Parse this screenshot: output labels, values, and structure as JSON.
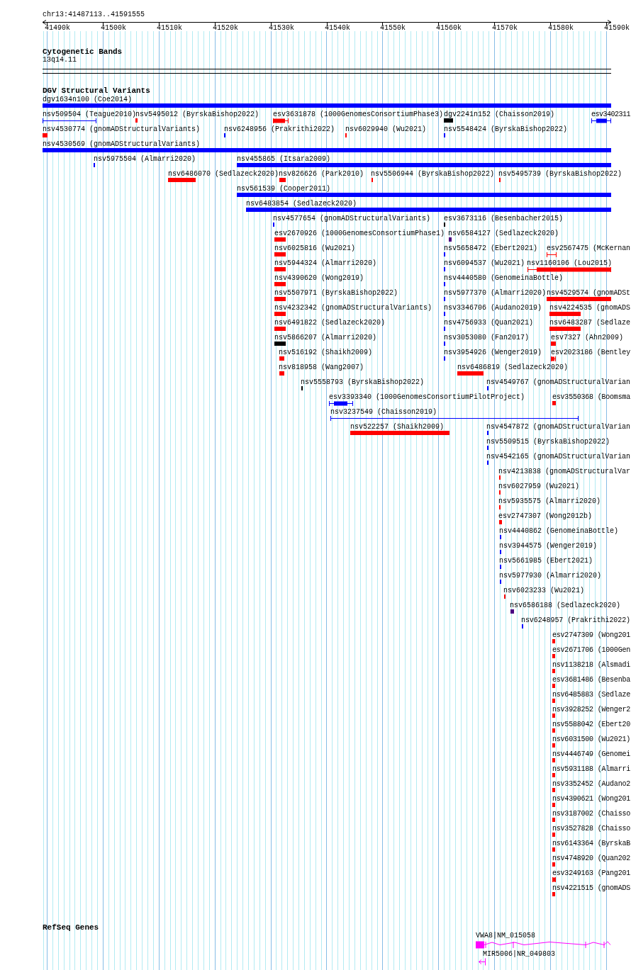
{
  "ruler": {
    "location": "chr13:41487113..41591555",
    "ticks": [
      "41490k",
      "41500k",
      "41510k",
      "41520k",
      "41530k",
      "41540k",
      "41550k",
      "41560k",
      "41570k",
      "41580k",
      "41590k"
    ]
  },
  "cytogenetic_bands": {
    "title": "Cytogenetic Bands",
    "band": "13q14.11"
  },
  "dgv_track": {
    "title": "DGV Structural Variants",
    "features": [
      {
        "label": "dgv1634n100 (Coe2014)",
        "color": "#0000ff",
        "kind": "bar"
      },
      {
        "label": "nsv509504 (Teague2010)",
        "color": "#0000ff",
        "kind": "span"
      },
      {
        "label": "nsv5495012 (ByrskaBishop2022)",
        "color": "#ff0000",
        "kind": "bar"
      },
      {
        "label": "esv3631878 (1000GenomesConsortiumPhase3)",
        "color": "#ff0000",
        "kind": "gapped"
      },
      {
        "label": "dgv2241n152 (Chaisson2019)",
        "color": "#000000",
        "kind": "bar"
      },
      {
        "label": "esv3402311",
        "color": "#0000ff",
        "kind": "gapped"
      },
      {
        "label": "nsv4530774 (gnomADStructuralVariants)",
        "color": "#ff0000",
        "kind": "bar"
      },
      {
        "label": "nsv6248956 (Prakrithi2022)",
        "color": "#0000ff",
        "kind": "bar"
      },
      {
        "label": "nsv6029940 (Wu2021)",
        "color": "#ff0000",
        "kind": "bar"
      },
      {
        "label": "nsv5548424 (ByrskaBishop2022)",
        "color": "#0000ff",
        "kind": "bar"
      },
      {
        "label": "nsv4530569 (gnomADStructuralVariants)",
        "color": "#0000ff",
        "kind": "bar"
      },
      {
        "label": "nsv5975504 (Almarri2020)",
        "color": "#0000ff",
        "kind": "bar"
      },
      {
        "label": "nsv455865 (Itsara2009)",
        "color": "#0000ff",
        "kind": "bar"
      },
      {
        "label": "nsv6486070 (Sedlazeck2020)",
        "color": "#ff0000",
        "kind": "bar"
      },
      {
        "label": "nsv826626 (Park2010)",
        "color": "#ff0000",
        "kind": "bar"
      },
      {
        "label": "nsv5506944 (ByrskaBishop2022)",
        "color": "#ff0000",
        "kind": "bar"
      },
      {
        "label": "nsv5495739 (ByrskaBishop2022)",
        "color": "#ff0000",
        "kind": "bar"
      },
      {
        "label": "nsv561539 (Cooper2011)",
        "color": "#0000ff",
        "kind": "bar"
      },
      {
        "label": "nsv6483854 (Sedlazeck2020)",
        "color": "#0000ff",
        "kind": "bar"
      },
      {
        "label": "nsv4577654 (gnomADStructuralVariants)",
        "color": "#0000ff",
        "kind": "bar"
      },
      {
        "label": "esv3673116 (Besenbacher2015)",
        "color": "#000000",
        "kind": "bar"
      },
      {
        "label": "esv2670926 (1000GenomesConsortiumPhase1)",
        "color": "#ff0000",
        "kind": "bar"
      },
      {
        "label": "nsv6584127 (Sedlazeck2020)",
        "color": "#4b0082",
        "kind": "bar"
      },
      {
        "label": "nsv6025816 (Wu2021)",
        "color": "#ff0000",
        "kind": "bar"
      },
      {
        "label": "nsv5658472 (Ebert2021)",
        "color": "#0000ff",
        "kind": "bar"
      },
      {
        "label": "esv2567475 (McKernan",
        "color": "#ff0000",
        "kind": "span"
      },
      {
        "label": "nsv5944324 (Almarri2020)",
        "color": "#ff0000",
        "kind": "bar"
      },
      {
        "label": "nsv6094537 (Wu2021)",
        "color": "#0000ff",
        "kind": "bar"
      },
      {
        "label": "nsv1160106 (Lou2015)",
        "color": "#ff0000",
        "kind": "gapped"
      },
      {
        "label": "nsv4390620 (Wong2019)",
        "color": "#ff0000",
        "kind": "bar"
      },
      {
        "label": "nsv4440580 (GenomeinaBottle)",
        "color": "#0000ff",
        "kind": "bar"
      },
      {
        "label": "nsv5507971 (ByrskaBishop2022)",
        "color": "#ff0000",
        "kind": "bar"
      },
      {
        "label": "nsv5977370 (Almarri2020)",
        "color": "#0000ff",
        "kind": "bar"
      },
      {
        "label": "nsv4529574 (gnomADSt",
        "color": "#ff0000",
        "kind": "bar"
      },
      {
        "label": "nsv4232342 (gnomADStructuralVariants)",
        "color": "#ff0000",
        "kind": "bar"
      },
      {
        "label": "nsv3346706 (Audano2019)",
        "color": "#0000ff",
        "kind": "bar"
      },
      {
        "label": "nsv4224535 (gnomADS",
        "color": "#ff0000",
        "kind": "bar"
      },
      {
        "label": "nsv6491822 (Sedlazeck2020)",
        "color": "#ff0000",
        "kind": "bar"
      },
      {
        "label": "nsv4756933 (Quan2021)",
        "color": "#0000ff",
        "kind": "bar"
      },
      {
        "label": "nsv6483287 (Sedlaze",
        "color": "#ff0000",
        "kind": "bar"
      },
      {
        "label": "nsv5866207 (Almarri2020)",
        "color": "#000000",
        "kind": "bar"
      },
      {
        "label": "nsv3053080 (Fan2017)",
        "color": "#0000ff",
        "kind": "bar"
      },
      {
        "label": "esv7327 (Ahn2009)",
        "color": "#ff0000",
        "kind": "bar"
      },
      {
        "label": "nsv516192 (Shaikh2009)",
        "color": "#ff0000",
        "kind": "bar"
      },
      {
        "label": "nsv3954926 (Wenger2019)",
        "color": "#0000ff",
        "kind": "bar"
      },
      {
        "label": "esv2023186 (Bentley",
        "color": "#ff0000",
        "kind": "gapped"
      },
      {
        "label": "nsv818958 (Wang2007)",
        "color": "#ff0000",
        "kind": "bar"
      },
      {
        "label": "nsv6486819 (Sedlazeck2020)",
        "color": "#ff0000",
        "kind": "bar"
      },
      {
        "label": "nsv5558793 (ByrskaBishop2022)",
        "color": "#000000",
        "kind": "bar"
      },
      {
        "label": "nsv4549767 (gnomADStructuralVarian",
        "color": "#0000ff",
        "kind": "bar"
      },
      {
        "label": "esv3393340 (1000GenomesConsortiumPilotProject)",
        "color": "#0000ff",
        "kind": "gapped"
      },
      {
        "label": "esv3550368 (Boomsma",
        "color": "#ff0000",
        "kind": "bar"
      },
      {
        "label": "nsv3237549 (Chaisson2019)",
        "color": "#0000ff",
        "kind": "span"
      },
      {
        "label": "nsv522257 (Shaikh2009)",
        "color": "#ff0000",
        "kind": "bar"
      },
      {
        "label": "nsv4547872 (gnomADStructuralVarian",
        "color": "#0000ff",
        "kind": "bar"
      },
      {
        "label": "nsv5509515 (ByrskaBishop2022)",
        "color": "#0000ff",
        "kind": "bar"
      },
      {
        "label": "nsv4542165 (gnomADStructuralVarian",
        "color": "#0000ff",
        "kind": "bar"
      },
      {
        "label": "nsv4213838 (gnomADStructuralVar",
        "color": "#ff0000",
        "kind": "bar"
      },
      {
        "label": "nsv6027959 (Wu2021)",
        "color": "#ff0000",
        "kind": "bar"
      },
      {
        "label": "nsv5935575 (Almarri2020)",
        "color": "#ff0000",
        "kind": "bar"
      },
      {
        "label": "esv2747307 (Wong2012b)",
        "color": "#ff0000",
        "kind": "bar"
      },
      {
        "label": "nsv4440862 (GenomeinaBottle)",
        "color": "#0000ff",
        "kind": "bar"
      },
      {
        "label": "nsv3944575 (Wenger2019)",
        "color": "#0000ff",
        "kind": "bar"
      },
      {
        "label": "nsv5661985 (Ebert2021)",
        "color": "#0000ff",
        "kind": "bar"
      },
      {
        "label": "nsv5977930 (Almarri2020)",
        "color": "#0000ff",
        "kind": "bar"
      },
      {
        "label": "nsv6023233 (Wu2021)",
        "color": "#ff0000",
        "kind": "bar"
      },
      {
        "label": "nsv6586188 (Sedlazeck2020)",
        "color": "#4b0082",
        "kind": "bar"
      },
      {
        "label": "nsv6248957 (Prakrithi2022)",
        "color": "#0000ff",
        "kind": "bar"
      },
      {
        "label": "esv2747309 (Wong201",
        "color": "#ff0000",
        "kind": "bar"
      },
      {
        "label": "esv2671706 (1000Gen",
        "color": "#ff0000",
        "kind": "bar"
      },
      {
        "label": "nsv1138218 (Alsmadi",
        "color": "#ff0000",
        "kind": "bar"
      },
      {
        "label": "esv3681486 (Besenba",
        "color": "#ff0000",
        "kind": "bar"
      },
      {
        "label": "nsv6485883 (Sedlaze",
        "color": "#ff0000",
        "kind": "bar"
      },
      {
        "label": "nsv3928252 (Wenger2",
        "color": "#ff0000",
        "kind": "bar"
      },
      {
        "label": "nsv5588042 (Ebert20",
        "color": "#ff0000",
        "kind": "bar"
      },
      {
        "label": "nsv6031500 (Wu2021)",
        "color": "#ff0000",
        "kind": "bar"
      },
      {
        "label": "nsv4446749 (Genomei",
        "color": "#ff0000",
        "kind": "bar"
      },
      {
        "label": "nsv5931188 (Almarri",
        "color": "#ff0000",
        "kind": "bar"
      },
      {
        "label": "nsv3352452 (Audano2",
        "color": "#ff0000",
        "kind": "bar"
      },
      {
        "label": "nsv4390621 (Wong201",
        "color": "#ff0000",
        "kind": "bar"
      },
      {
        "label": "nsv3187002 (Chaisso",
        "color": "#ff0000",
        "kind": "bar"
      },
      {
        "label": "nsv3527828 (Chaisso",
        "color": "#ff0000",
        "kind": "bar"
      },
      {
        "label": "nsv6143364 (ByrskaB",
        "color": "#ff0000",
        "kind": "bar"
      },
      {
        "label": "nsv4748920 (Quan202",
        "color": "#ff0000",
        "kind": "bar"
      },
      {
        "label": "esv3249163 (Pang201",
        "color": "#ff0000",
        "kind": "gapped"
      },
      {
        "label": "nsv4221515 (gnomADS",
        "color": "#ff0000",
        "kind": "bar"
      }
    ]
  },
  "refseq_track": {
    "title": "RefSeq Genes",
    "genes": [
      {
        "label": "VWA8|NM_015058",
        "kind": "coding"
      },
      {
        "label": "MIR5006|NR_049803",
        "kind": "mirna"
      }
    ]
  }
}
